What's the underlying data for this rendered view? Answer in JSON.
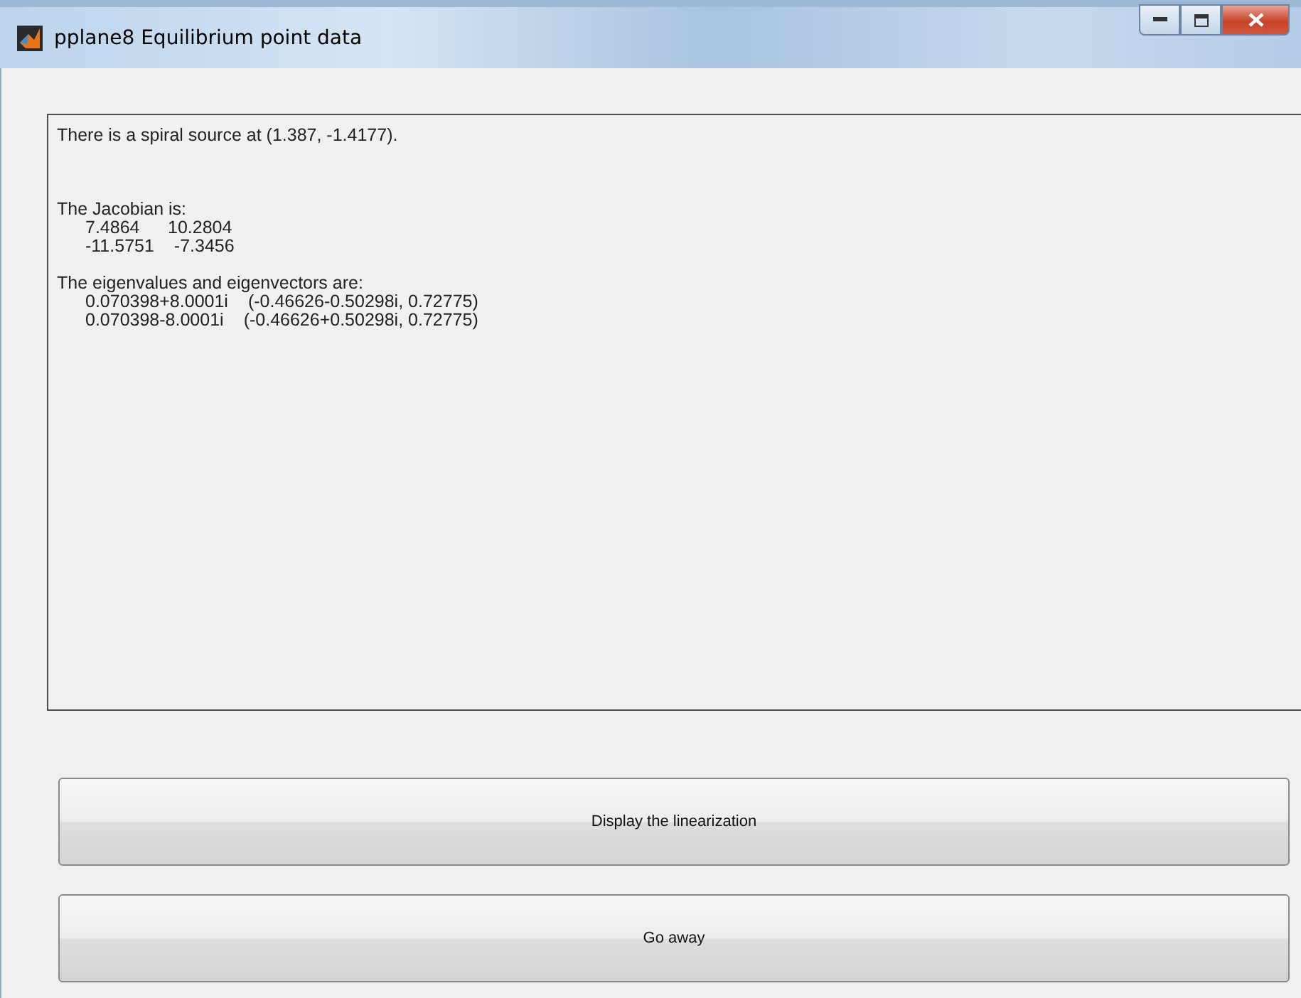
{
  "window": {
    "title": "pplane8 Equilibrium point data"
  },
  "output": {
    "sections": [
      {
        "heading": "There is a spiral source at (1.387, -1.4177)."
      },
      {
        "heading": "The Jacobian is:",
        "rows": [
          [
            "7.4864",
            "10.2804"
          ],
          [
            "-11.5751",
            "-7.3456"
          ]
        ]
      },
      {
        "heading": "The eigenvalues and eigenvectors are:",
        "rows": [
          [
            "0.070398+8.0001i",
            "(-0.46626-0.50298i, 0.72775)"
          ],
          [
            "0.070398-8.0001i",
            "(-0.46626+0.50298i, 0.72775)"
          ]
        ]
      }
    ]
  },
  "buttons": [
    "Display the linearization",
    "Go away"
  ]
}
